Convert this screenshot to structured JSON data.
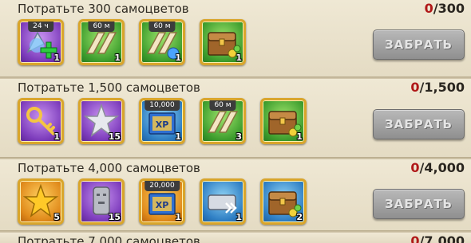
{
  "rows": [
    {
      "title": "Потратьте 300 самоцветов",
      "progress_current": "0",
      "progress_separator": "/",
      "progress_goal": "300",
      "claim_label": "ЗАБРАТЬ",
      "items": [
        {
          "icon": "speedup-24h-heal-icon",
          "tag": "24 ч",
          "qty": "1",
          "color": "purple"
        },
        {
          "icon": "speedup-60m-icon",
          "tag": "60 м",
          "qty": "1",
          "color": "green"
        },
        {
          "icon": "speedup-60m-icon",
          "tag": "60 м",
          "qty": "1",
          "color": "green"
        },
        {
          "icon": "resource-chest-icon",
          "tag": "",
          "qty": "1",
          "color": "green"
        }
      ]
    },
    {
      "title": "Потратьте 1,500 самоцветов",
      "progress_current": "0",
      "progress_separator": "/",
      "progress_goal": "1,500",
      "claim_label": "ЗАБРАТЬ",
      "items": [
        {
          "icon": "gold-key-icon",
          "tag": "",
          "qty": "1",
          "color": "purple"
        },
        {
          "icon": "silver-star-icon",
          "tag": "",
          "qty": "15",
          "color": "purple"
        },
        {
          "icon": "xp-book-icon",
          "tag": "10,000",
          "qty": "1",
          "color": "blue"
        },
        {
          "icon": "speedup-60m-icon",
          "tag": "60 м",
          "qty": "3",
          "color": "green"
        },
        {
          "icon": "resource-chest-icon",
          "tag": "",
          "qty": "1",
          "color": "green"
        }
      ]
    },
    {
      "title": "Потратьте 4,000 самоцветов",
      "progress_current": "0",
      "progress_separator": "/",
      "progress_goal": "4,000",
      "claim_label": "ЗАБРАТЬ",
      "items": [
        {
          "icon": "gold-star-icon",
          "tag": "",
          "qty": "5",
          "color": "orange"
        },
        {
          "icon": "statue-head-icon",
          "tag": "",
          "qty": "15",
          "color": "purple"
        },
        {
          "icon": "xp-book-icon",
          "tag": "20,000",
          "qty": "1",
          "color": "orange"
        },
        {
          "icon": "teleport-icon",
          "tag": "",
          "qty": "1",
          "color": "blue"
        },
        {
          "icon": "resource-chest-icon",
          "tag": "",
          "qty": "2",
          "color": "blue"
        }
      ]
    },
    {
      "title": "Потратьте 7,000 самоцветов",
      "progress_current": "0",
      "progress_separator": "/",
      "progress_goal": "7,000"
    }
  ]
}
